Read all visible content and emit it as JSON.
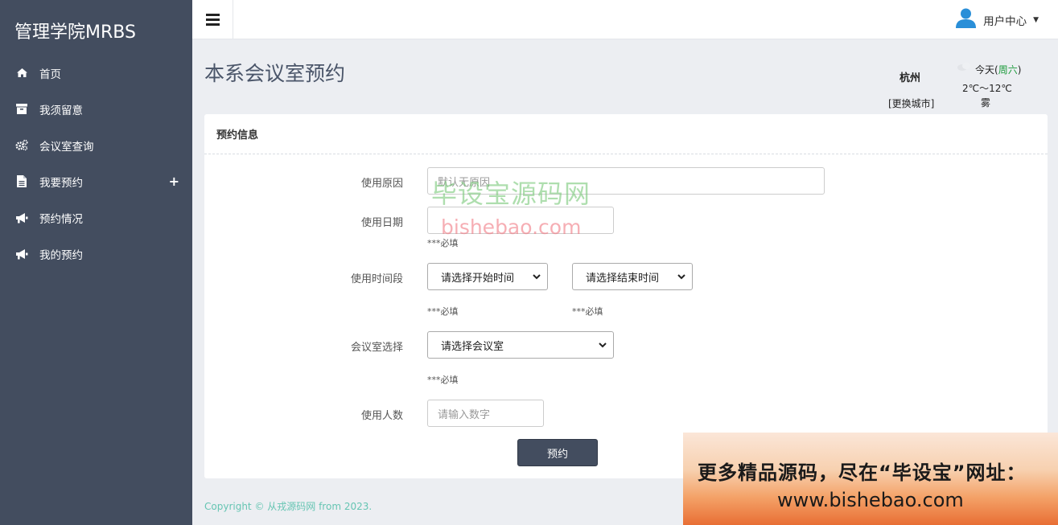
{
  "brand": "管理学院MRBS",
  "sidebar": {
    "items": [
      {
        "label": "首页",
        "icon": "home-icon"
      },
      {
        "label": "我须留意",
        "icon": "archive-icon"
      },
      {
        "label": "会议室查询",
        "icon": "gears-icon"
      },
      {
        "label": "我要预约",
        "icon": "file-icon",
        "expand": "+"
      },
      {
        "label": "预约情况",
        "icon": "megaphone-icon"
      },
      {
        "label": "我的预约",
        "icon": "megaphone-icon"
      }
    ]
  },
  "topbar": {
    "user_label": "用户中心"
  },
  "page": {
    "title": "本系会议室预约"
  },
  "weather": {
    "city": "杭州",
    "change_city": "[更换城市]",
    "today": "今天(",
    "weekday": "周六",
    "today_close": ")",
    "temp": "2℃～12℃",
    "condition": "雾"
  },
  "card": {
    "header": "预约信息"
  },
  "form": {
    "reason_label": "使用原因",
    "reason_placeholder": "默认无原因",
    "date_label": "使用日期",
    "date_required": "***必填",
    "time_label": "使用时间段",
    "start_select": "请选择开始时间",
    "end_select": "请选择结束时间",
    "start_required": "***必填",
    "end_required": "***必填",
    "room_label": "会议室选择",
    "room_select": "请选择会议室",
    "room_required": "***必填",
    "people_label": "使用人数",
    "people_placeholder": "请输入数字",
    "submit": "预约"
  },
  "watermark": {
    "line1": "毕设宝源码网",
    "line2": "bishebao.com"
  },
  "footer": {
    "copyright": "Copyright © 从戎源码网 from 2023."
  },
  "banner": {
    "line1": "更多精品源码，尽在“毕设宝”网址：",
    "line2": "www.bishebao.com"
  }
}
